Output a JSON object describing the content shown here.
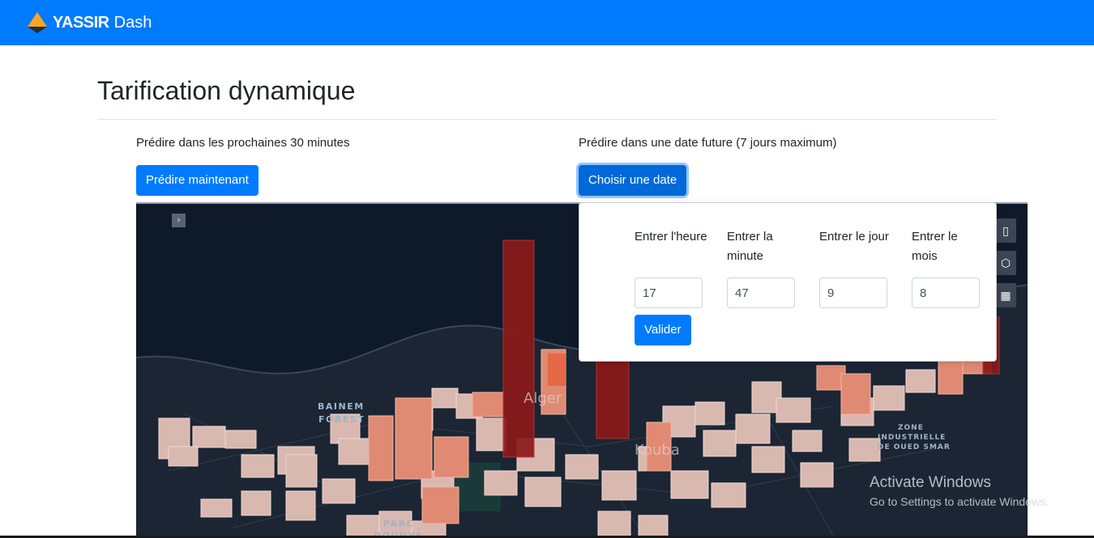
{
  "navbar": {
    "brand": "YASSIR",
    "app": "Dash"
  },
  "page": {
    "title": "Tarification dynamique"
  },
  "left_panel": {
    "label": "Prédire dans les prochaines 30 minutes",
    "button": "Prédire maintenant"
  },
  "right_panel": {
    "label": "Prédire dans une date future (7 jours maximum)",
    "button": "Choisir une date"
  },
  "date_form": {
    "fields": [
      {
        "label": "Entrer l'heure",
        "value": "17"
      },
      {
        "label": "Entrer la minute",
        "value": "47"
      },
      {
        "label": "Entrer le jour",
        "value": "9"
      },
      {
        "label": "Entrer le mois",
        "value": "8"
      }
    ],
    "submit": "Valider"
  },
  "map": {
    "labels": [
      {
        "text": "BAINEM"
      },
      {
        "text": "FOREST"
      },
      {
        "text": "Alger"
      },
      {
        "text": "Kouba"
      },
      {
        "text": "ZONE"
      },
      {
        "text": "INDUSTRIELLE"
      },
      {
        "text": "DE OUED SMAR"
      },
      {
        "text": "PARC"
      },
      {
        "text": "DOUNYA"
      }
    ],
    "controls": [
      "map-icon",
      "3d-cube-icon",
      "table-icon"
    ]
  },
  "windows_watermark": {
    "title": "Activate Windows",
    "subtitle": "Go to Settings to activate Windows."
  },
  "colors": {
    "primary": "#007bff",
    "map_bg": "#0e1a29",
    "bar_dark_red": "#8b1a1a",
    "bar_salmon": "#e07a5f",
    "bar_pink": "#d9b3aa"
  }
}
